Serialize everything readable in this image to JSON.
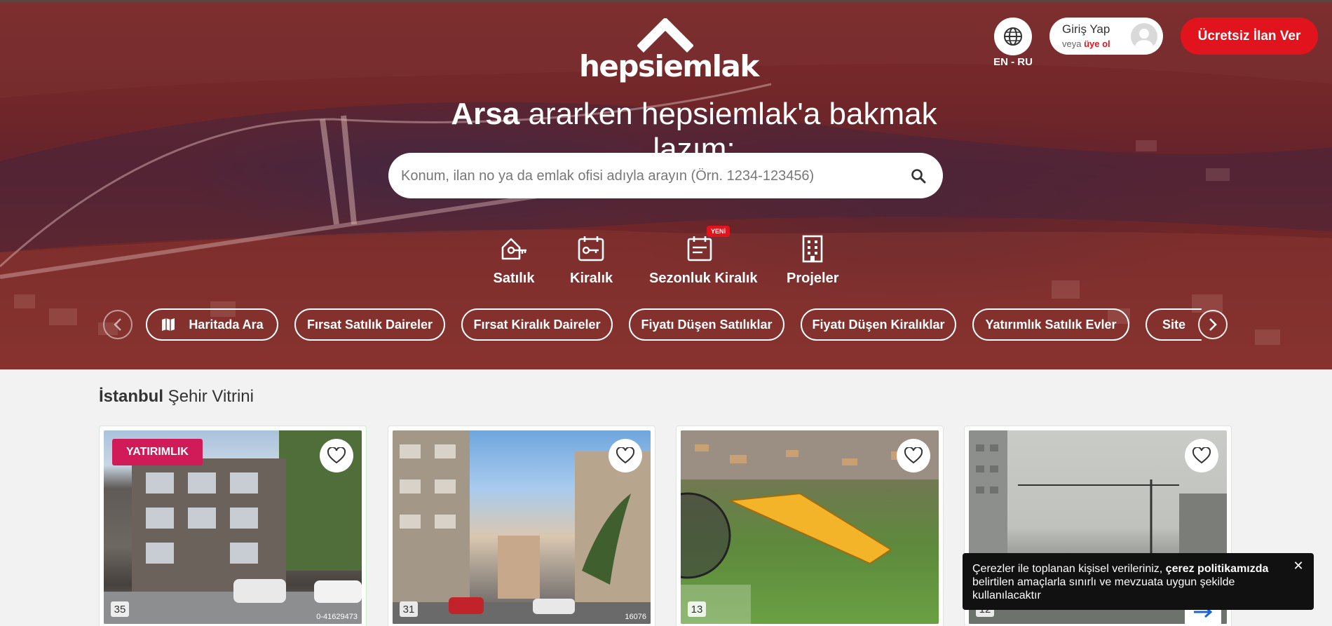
{
  "header": {
    "logo_text": "hepsiemlak",
    "lang_label": "EN - RU",
    "login_title": "Giriş Yap",
    "login_sub_prefix": "veya",
    "login_sub_link": "üye ol",
    "cta_label": "Ücretsiz İlan Ver",
    "brand_color": "#e1141d"
  },
  "hero": {
    "headline_bold": "Arsa",
    "headline_rest": " ararken hepsiemlak'a bakmak lazım;"
  },
  "search": {
    "placeholder": "Konum, ilan no ya da emlak ofisi adıyla arayın (Örn. 1234-123456)"
  },
  "categories": [
    {
      "label": "Satılık",
      "icon": "house-key-icon"
    },
    {
      "label": "Kiralık",
      "icon": "key-tag-icon"
    },
    {
      "label": "Sezonluk Kiralık",
      "icon": "calendar-icon",
      "badge": "YENİ"
    },
    {
      "label": "Projeler",
      "icon": "building-icon"
    }
  ],
  "chips": [
    "Haritada Ara",
    "Fırsat Satılık Daireler",
    "Fırsat Kiralık Daireler",
    "Fiyatı Düşen Satılıklar",
    "Fiyatı Düşen Kiralıklar",
    "Yatırımlık Satılık Evler",
    "Site"
  ],
  "showcase": {
    "title_bold": "İstanbul",
    "title_rest": " Şehir Vitrini",
    "cards": [
      {
        "tag": "YATIRIMLIK",
        "photo_count": "35",
        "listing_no": "0-41629473"
      },
      {
        "photo_count": "31",
        "listing_no": "16076"
      },
      {
        "photo_count": "13",
        "listing_no": ""
      },
      {
        "photo_count": "12",
        "listing_no": ""
      }
    ]
  },
  "cookie": {
    "text_before": "Çerezler ile toplanan kişisel verileriniz, ",
    "text_bold": "çerez politikamızda",
    "text_after": " belirtilen amaçlarla sınırlı ve mevzuata uygun şekilde kullanılacaktır",
    "close": "✕"
  }
}
